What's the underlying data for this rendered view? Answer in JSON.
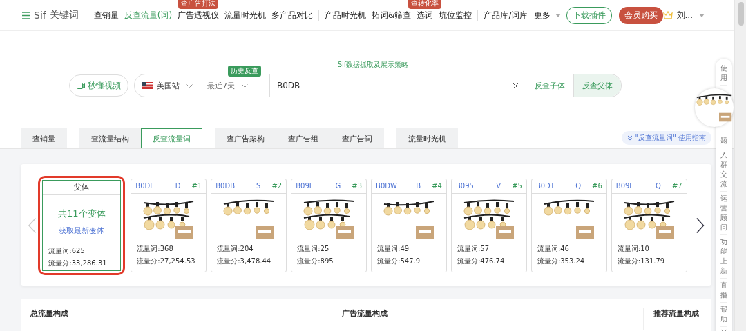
{
  "nav": {
    "logo": "Sif",
    "logo_sub": "关键词",
    "items": [
      {
        "label": "查销量",
        "selected": false
      },
      {
        "label": "反查流量(词)",
        "selected": true
      },
      {
        "label": "广告透视仪",
        "selected": false,
        "badge": "查广告打法"
      },
      {
        "label": "流量时光机",
        "selected": false
      },
      {
        "label": "多产品对比",
        "selected": false
      },
      {
        "label": "产品时光机",
        "selected": false,
        "divider": true
      },
      {
        "label": "拓词&筛查",
        "selected": false
      },
      {
        "label": "选词",
        "selected": false,
        "badge": "查转化率"
      },
      {
        "label": "坑位监控",
        "selected": false
      },
      {
        "label": "产品库/词库",
        "selected": false,
        "divider": true
      },
      {
        "label": "更多",
        "selected": false,
        "dropdown": true
      }
    ],
    "download": "下载插件",
    "buy": "会员购买",
    "user": "刘..."
  },
  "search": {
    "subtitle": "Sif数据抓取及展示策略",
    "video": "秒懂视频",
    "site": "美国站",
    "period": "最近7天",
    "history_badge": "历史反查",
    "value": "B0DB",
    "child_btn": "反查子体",
    "parent_btn": "反查父体"
  },
  "tabs": [
    {
      "label": "查销量",
      "selected": false
    },
    {
      "label": "查流量结构",
      "selected": false
    },
    {
      "label": "反查流量词",
      "selected": true
    },
    {
      "label": "查广告架构",
      "selected": false
    },
    {
      "label": "查广告组",
      "selected": false
    },
    {
      "label": "查广告词",
      "selected": false
    },
    {
      "label": "流量时光机",
      "selected": false
    }
  ],
  "guide": "\"反查流量词\" 使用指南",
  "parent": {
    "title": "父体",
    "count": "共11个变体",
    "link": "获取最新变体",
    "words": "流量词:625",
    "score": "流量分:33,286.31"
  },
  "variants": [
    {
      "code": "B0DE",
      "code_end": "D",
      "rank": "#1",
      "words": "流量词:368",
      "score": "流量分:27,254.53"
    },
    {
      "code": "B0DB",
      "code_end": "S",
      "rank": "#2",
      "words": "流量词:204",
      "score": "流量分:3,478.44"
    },
    {
      "code": "B09F",
      "code_end": "G",
      "rank": "#3",
      "words": "流量词:25",
      "score": "流量分:895"
    },
    {
      "code": "B0DW",
      "code_end": "B",
      "rank": "#4",
      "words": "流量词:49",
      "score": "流量分:547.9"
    },
    {
      "code": "B095",
      "code_end": "V",
      "rank": "#5",
      "words": "流量词:57",
      "score": "流量分:476.74"
    },
    {
      "code": "B0DT",
      "code_end": "Q",
      "rank": "#6",
      "words": "流量词:46",
      "score": "流量分:353.24"
    },
    {
      "code": "B09F",
      "code_end": "Q",
      "rank": "#7",
      "words": "流量词:10",
      "score": "流量分:131.79"
    }
  ],
  "sections": [
    "总流量构成",
    "广告流量构成",
    "推荐流量构成"
  ],
  "side": [
    "使用",
    "题",
    "入群交流",
    "运营顾问",
    "功能上新",
    "直播",
    "帮助"
  ]
}
